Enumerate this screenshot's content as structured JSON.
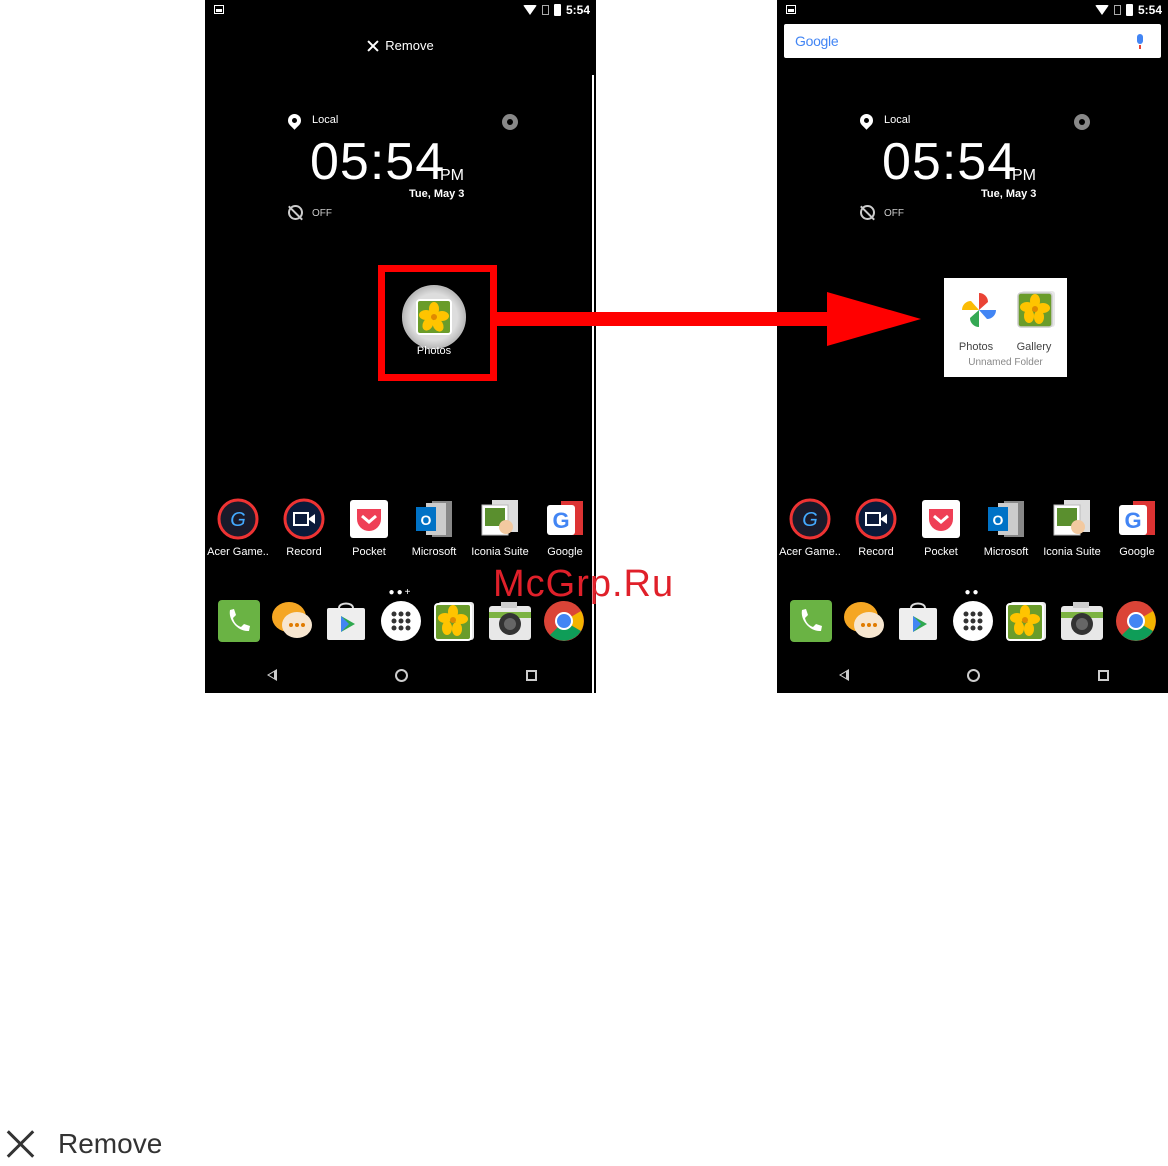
{
  "status_bar": {
    "time": "5:54"
  },
  "left_screen": {
    "remove_label": "Remove",
    "dragged_app_label": "Photos"
  },
  "right_screen": {
    "search_brand": "Google",
    "folder": {
      "items": [
        "Photos",
        "Gallery"
      ],
      "name": "Unnamed Folder"
    }
  },
  "clock": {
    "location": "Local",
    "time": "05:54",
    "ampm": "PM",
    "date": "Tue, May 3",
    "alarm": "OFF"
  },
  "app_row": [
    "Acer Game..",
    "Record",
    "Pocket",
    "Microsoft",
    "Iconia Suite",
    "Google"
  ],
  "watermark": "McGrp.Ru",
  "bottom_caption": {
    "label": "Remove"
  },
  "colors": {
    "highlight": "#ff0000",
    "watermark": "#e0202a",
    "screen_bg": "#000000"
  }
}
